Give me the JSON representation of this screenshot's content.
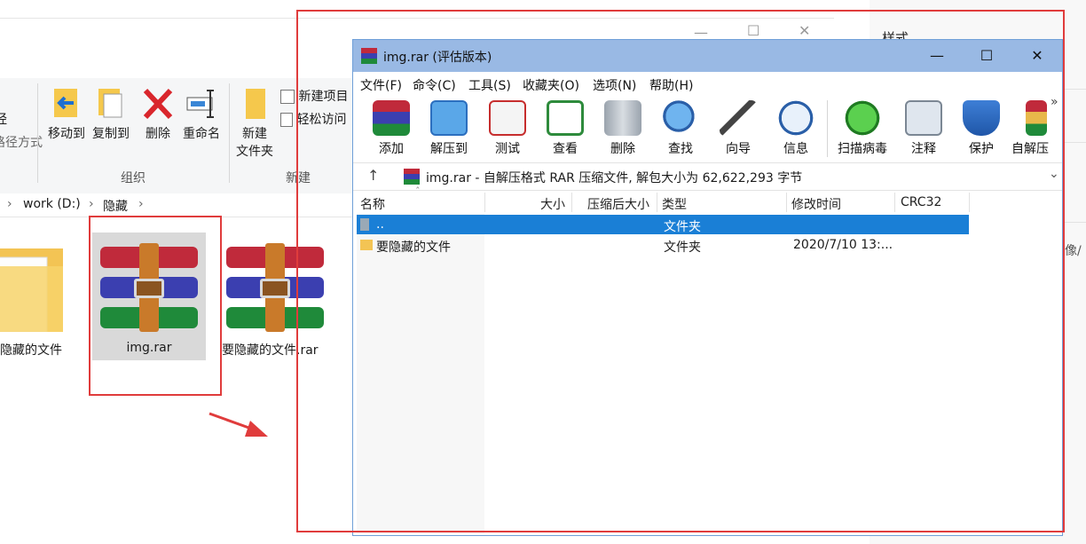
{
  "explorer": {
    "ribbon": {
      "partial_left_top": "经",
      "partial_left_bottom": "路径方式",
      "move_to": "移动到",
      "copy_to": "复制到",
      "delete": "删除",
      "rename": "重命名",
      "new_folder_line1": "新建",
      "new_folder_line2": "文件夹",
      "new_item": "新建项目",
      "easy_access": "轻松访问",
      "group_organize": "组织",
      "group_new": "新建"
    },
    "address": {
      "drive": "work (D:)",
      "folder": "隐藏"
    },
    "files": [
      {
        "name": "隐藏的文件"
      },
      {
        "name": "img.rar"
      },
      {
        "name": "要隐藏的文件.rar"
      }
    ],
    "right_pane": {
      "heading": "样式",
      "partial": "像/"
    }
  },
  "rar": {
    "title": "img.rar (评估版本)",
    "menu": [
      "文件(F)",
      "命令(C)",
      "工具(S)",
      "收藏夹(O)",
      "选项(N)",
      "帮助(H)"
    ],
    "toolbar": [
      {
        "label": "添加",
        "icon": "add-icon"
      },
      {
        "label": "解压到",
        "icon": "extract-icon"
      },
      {
        "label": "测试",
        "icon": "test-icon"
      },
      {
        "label": "查看",
        "icon": "view-icon"
      },
      {
        "label": "删除",
        "icon": "delete-icon"
      },
      {
        "label": "查找",
        "icon": "find-icon"
      },
      {
        "label": "向导",
        "icon": "wizard-icon"
      },
      {
        "label": "信息",
        "icon": "info-icon"
      },
      {
        "label": "扫描病毒",
        "icon": "virus-scan-icon"
      },
      {
        "label": "注释",
        "icon": "comment-icon"
      },
      {
        "label": "保护",
        "icon": "protect-icon"
      },
      {
        "label": "自解压",
        "icon": "sfx-icon"
      }
    ],
    "path_text": "img.rar - 自解压格式 RAR 压缩文件, 解包大小为 62,622,293 字节",
    "columns": [
      "名称",
      "大小",
      "压缩后大小",
      "类型",
      "修改时间",
      "CRC32"
    ],
    "rows": [
      {
        "name": "..",
        "size": "",
        "packed": "",
        "type": "文件夹",
        "modified": "",
        "crc": ""
      },
      {
        "name": "要隐藏的文件",
        "size": "",
        "packed": "",
        "type": "文件夹",
        "modified": "2020/7/10 13:...",
        "crc": ""
      }
    ]
  },
  "colors": {
    "annotation_red": "#e03c3c",
    "title_bar": "#99b9e4",
    "selection": "#1a7fd6"
  }
}
